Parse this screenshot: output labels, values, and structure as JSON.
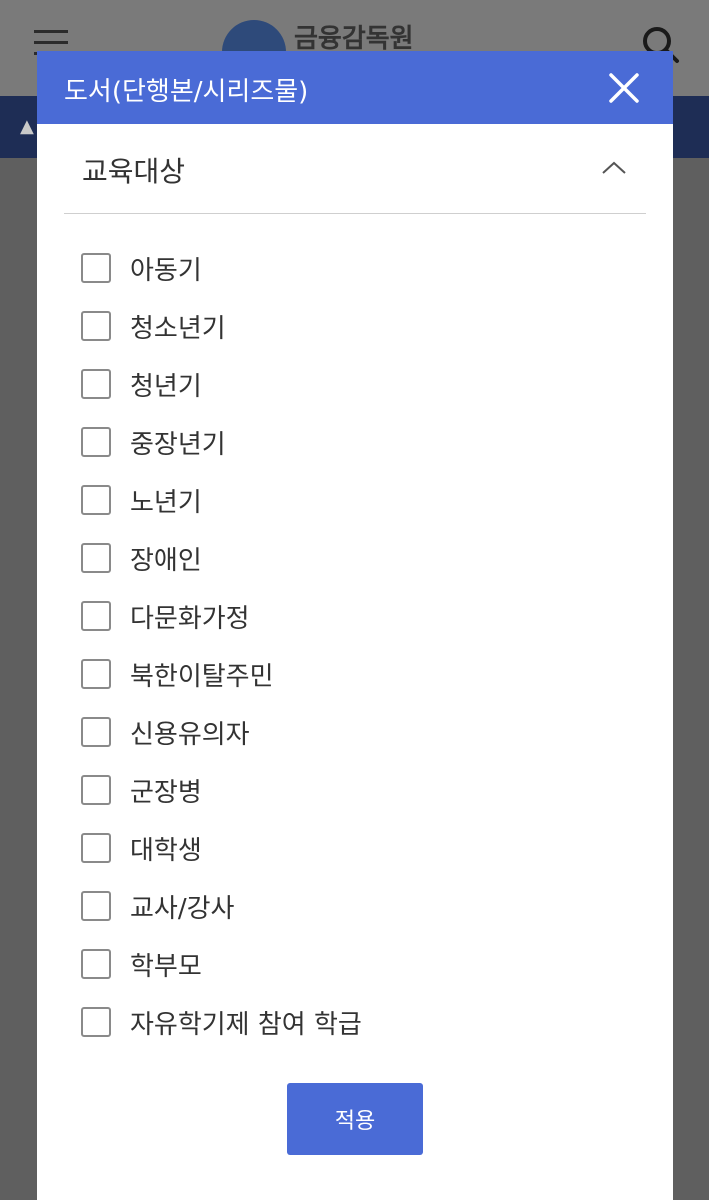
{
  "background": {
    "logo_text": "금융감독원",
    "menu_icon": "hamburger-menu-icon",
    "search_icon": "search-icon"
  },
  "modal": {
    "title": "도서(단행본/시리즈물)",
    "close_icon": "close-icon",
    "section_title": "교육대상",
    "section_icon": "chevron-up-icon",
    "options": [
      {
        "label": "아동기",
        "checked": false
      },
      {
        "label": "청소년기",
        "checked": false
      },
      {
        "label": "청년기",
        "checked": false
      },
      {
        "label": "중장년기",
        "checked": false
      },
      {
        "label": "노년기",
        "checked": false
      },
      {
        "label": "장애인",
        "checked": false
      },
      {
        "label": "다문화가정",
        "checked": false
      },
      {
        "label": "북한이탈주민",
        "checked": false
      },
      {
        "label": "신용유의자",
        "checked": false
      },
      {
        "label": "군장병",
        "checked": false
      },
      {
        "label": "대학생",
        "checked": false
      },
      {
        "label": "교사/강사",
        "checked": false
      },
      {
        "label": "학부모",
        "checked": false
      },
      {
        "label": "자유학기제 참여 학급",
        "checked": false
      }
    ],
    "apply_label": "적용",
    "accent_color": "#4a6bd6"
  }
}
